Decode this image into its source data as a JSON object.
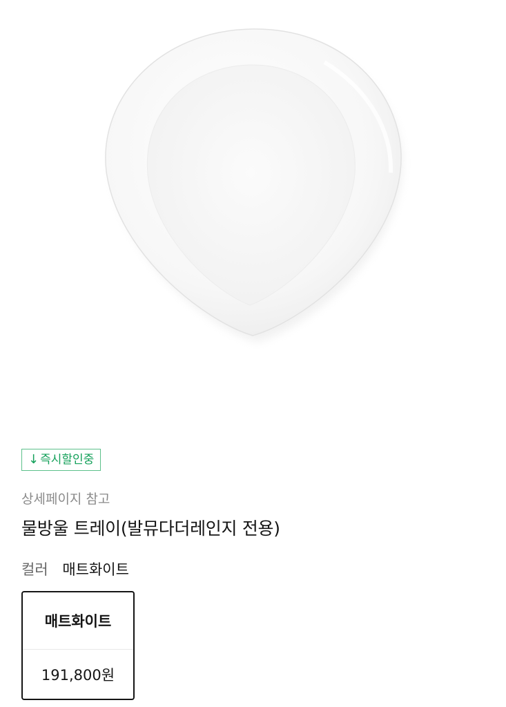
{
  "product": {
    "image_alt": "white drop-shaped tray",
    "badge": {
      "icon": "down-arrow-icon",
      "arrow_glyph": "↓",
      "label": "즉시할인중",
      "color": "#14a05a"
    },
    "subtitle": "상세페이지 참고",
    "title": "물방울 트레이(발뮤다더레인지 전용)",
    "color_label": "컬러",
    "color_value": "매트화이트"
  },
  "options": [
    {
      "name": "매트화이트",
      "price": "191,800원",
      "selected": true
    }
  ]
}
